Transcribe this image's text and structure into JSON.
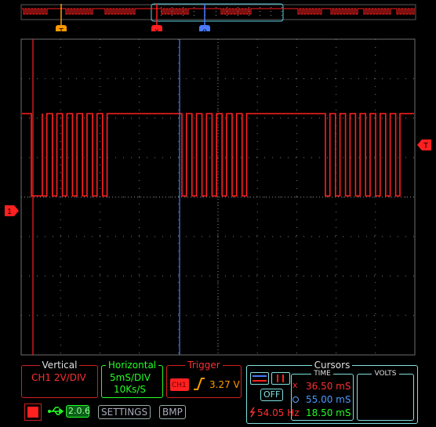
{
  "colors": {
    "channel": "#ff2020",
    "cursor_b": "#4a7bff",
    "grid": "#6e6e6e",
    "trigger": "#ff9a00",
    "horizontal": "#23ff23",
    "cursors_panel": "#7fe0e0"
  },
  "markers": {
    "trigger_time": "T",
    "cursor_a": "x",
    "cursor_b": "o",
    "channel_level": "1",
    "trigger_level": "T"
  },
  "vertical": {
    "title": "Vertical",
    "value": "CH1 2V/DIV"
  },
  "horizontal": {
    "title": "Horizontal",
    "timebase": "5mS/DIV",
    "sample_rate": "10Ks/S"
  },
  "trigger": {
    "title": "Trigger",
    "source": "CH1",
    "edge_icon": "rising-edge-icon",
    "level": "3.27 V"
  },
  "cursors": {
    "title": "Cursors",
    "time_title": "TIME",
    "volts_title": "VOLTS",
    "off_label": "OFF",
    "cursor_a_time": "36.50 mS",
    "cursor_b_time": "55.00 mS",
    "delta_time": "18.50 mS",
    "frequency": "54.05 Hz"
  },
  "bottom": {
    "usb_version": "2.0.6",
    "settings_label": "SETTINGS",
    "bmp_label": "BMP",
    "run_stop_icon": "stop-icon"
  }
}
